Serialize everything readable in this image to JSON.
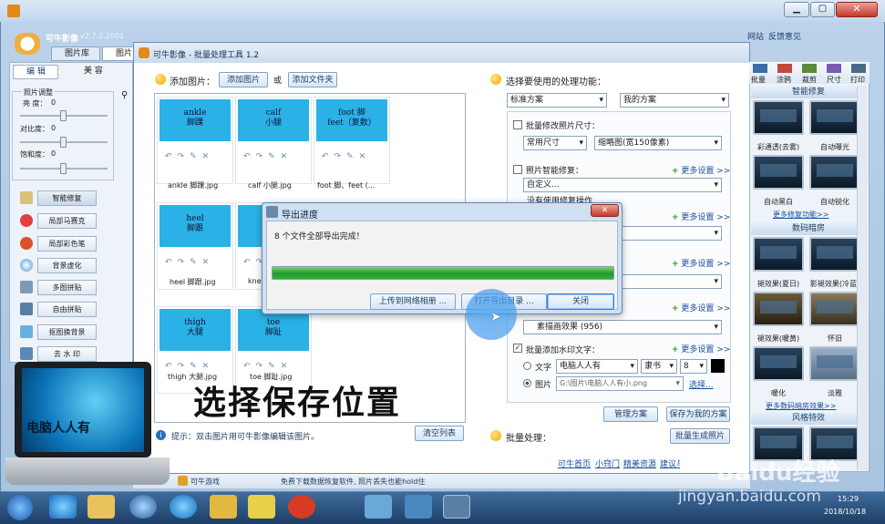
{
  "main_window": {
    "title": "可牛影像",
    "version": "v2.7.2.2001",
    "tab_library": "图片库",
    "tab_edit": "图片",
    "network": "网站",
    "feedback": "反馈意见"
  },
  "left_panel": {
    "tab_edit": "编 辑",
    "tab_beauty": "美 容",
    "group_title": "照片调整",
    "sliders": [
      {
        "label": "亮 度：",
        "value": "0"
      },
      {
        "label": "对比度：",
        "value": "0"
      },
      {
        "label": "饱和度：",
        "value": "0"
      }
    ],
    "buttons": [
      "智能修复",
      "局部马赛克",
      "局部彩色笔",
      "背景虚化",
      "多图拼贴",
      "自由拼贴",
      "抠图换背景",
      "去 水 印"
    ]
  },
  "batch": {
    "title": "可牛影像 - 批量处理工具 1.2",
    "add_images_label": "添加图片：",
    "add_image_btn": "添加图片",
    "or": "或",
    "add_folder_btn": "添加文件夹",
    "thumbs": [
      {
        "line1": "ankle",
        "line2": "脚踝",
        "caption": "ankle 脚踝.jpg"
      },
      {
        "line1": "calf",
        "line2": "小腿",
        "caption": "calf 小腿.jpg"
      },
      {
        "line1": "foot 脚",
        "line2": "feet（复数）",
        "caption": "foot 脚、feet (..."
      },
      {
        "line1": "heel",
        "line2": "脚跟",
        "caption": "heel 脚跟.jpg"
      },
      {
        "line1": "",
        "line2": "",
        "caption": "knee"
      },
      {
        "line1": "thigh",
        "line2": "大腿",
        "caption": "thigh 大腿.jpg"
      },
      {
        "line1": "toe",
        "line2": "脚趾",
        "caption": "toe 脚趾.jpg"
      }
    ],
    "tip": "提示：双击图片用可牛影像编辑该图片。",
    "clear_list": "清空列表",
    "func_title": "选择要使用的处理功能：",
    "scheme": "标准方案",
    "my_scheme": "我的方案",
    "resize_label": "批量修改照片尺寸：",
    "size_preset": "常用尺寸",
    "size_value": "缩略图(宽150像素)",
    "smart_fix_label": "照片智能修复：",
    "more_settings": "更多设置 >>",
    "custom": "自定义...",
    "no_fix": "没有使用修复操作",
    "effect_value": "素描画效果 (956)",
    "watermark_label": "批量添加水印文字：",
    "wm_text_label": "文字",
    "wm_text_value": "电脑人人有",
    "wm_font": "隶书",
    "wm_size": "8",
    "wm_image_label": "图片",
    "wm_image_path": "G:\\图片\\电脑人人有小.png",
    "browse": "选择...",
    "manage_scheme": "管理方案",
    "save_scheme": "保存为我的方案",
    "batch_label": "批量处理：",
    "batch_generate": "批量生成照片",
    "footer_links": [
      "可牛首页",
      "小窍门",
      "精美资源",
      "建议与反馈"
    ]
  },
  "dialog": {
    "title": "导出进度",
    "message": "8 个文件全部导出完成！",
    "progress": 1.0,
    "upload_btn": "上传到网络相册 ...",
    "open_dir_btn": "打开导出目录 ...",
    "close_btn": "关闭"
  },
  "right_panel": {
    "toolbar": [
      "批量",
      "涂鸦",
      "裁剪",
      "尺寸",
      "打印"
    ],
    "sections": [
      {
        "title": "智能修复",
        "items": [
          "彩通透(去雾)",
          "自动曝光",
          "自动黑白",
          "自动锐化"
        ],
        "more": "更多修复功能>>"
      },
      {
        "title": "数码暗房",
        "items": [
          "褪效果(夏日)",
          "影褪效果(冷蓝)",
          "褪效果(暖黄)",
          "怀旧",
          "暖化",
          "淡雅"
        ],
        "more": "更多数码暗房效果>>"
      },
      {
        "title": "风格特效",
        "items": []
      }
    ],
    "thumb_text": "电脑人人有"
  },
  "status_bar": {
    "game": "可牛游戏",
    "hint": "免费下载数据恢复软件, 照片丢失也能hold住"
  },
  "overlay": {
    "caption": "选择保存位置",
    "laptop_text": "电脑人人有"
  },
  "taskbar": {
    "time": "15:29",
    "date": "2018/10/18"
  },
  "watermark": {
    "logo": "Baidu经验",
    "url": "jingyan.baidu.com"
  },
  "colors": {
    "title_bar": "#d5e3f3",
    "accent": "#2ab2e6",
    "progress": "#1e9a2a",
    "dialog_border": "#5d8ab9"
  }
}
